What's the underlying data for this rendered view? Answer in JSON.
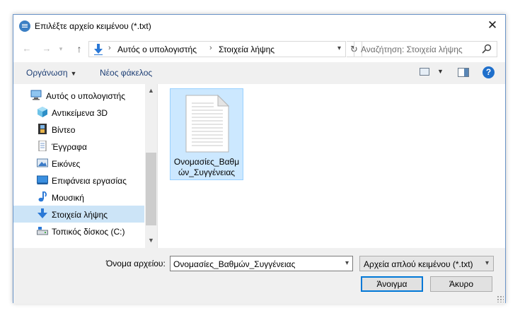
{
  "window": {
    "title": "Επιλέξτε αρχείο κειμένου (*.txt)"
  },
  "address_bar": {
    "crumbs": [
      "Αυτός ο υπολογιστής",
      "Στοιχεία λήψης"
    ]
  },
  "search": {
    "placeholder": "Αναζήτηση: Στοιχεία λήψης"
  },
  "toolbar": {
    "organize_label": "Οργάνωση",
    "new_folder_label": "Νέος φάκελος"
  },
  "nav_pane": {
    "items": [
      {
        "label": "Αυτός ο υπολογιστής",
        "icon": "computer-icon",
        "selected": false
      },
      {
        "label": "Αντικείμενα 3D",
        "icon": "cube-icon",
        "selected": false
      },
      {
        "label": "Βίντεο",
        "icon": "film-icon",
        "selected": false
      },
      {
        "label": "Έγγραφα",
        "icon": "document-icon",
        "selected": false
      },
      {
        "label": "Εικόνες",
        "icon": "pictures-icon",
        "selected": false
      },
      {
        "label": "Επιφάνεια εργασίας",
        "icon": "desktop-icon",
        "selected": false
      },
      {
        "label": "Μουσική",
        "icon": "music-icon",
        "selected": false
      },
      {
        "label": "Στοιχεία λήψης",
        "icon": "download-icon",
        "selected": true
      },
      {
        "label": "Τοπικός δίσκος (C:)",
        "icon": "drive-icon",
        "selected": false
      }
    ]
  },
  "files": [
    {
      "name_line1": "Ονομασίες_Βαθμ",
      "name_line2": "ών_Συγγένειας",
      "type": "text-file-icon",
      "selected": true
    }
  ],
  "footer": {
    "filename_label": "Όνομα αρχείου:",
    "filename_value": "Ονομασίες_Βαθμών_Συγγένειας",
    "filetype_value": "Αρχεία απλού κειμένου (*.txt)",
    "open_label": "Άνοιγμα",
    "cancel_label": "Άκυρο"
  },
  "colors": {
    "accent": "#0078d7",
    "selection": "#cce8ff",
    "nav_selection": "#cce4f7"
  }
}
